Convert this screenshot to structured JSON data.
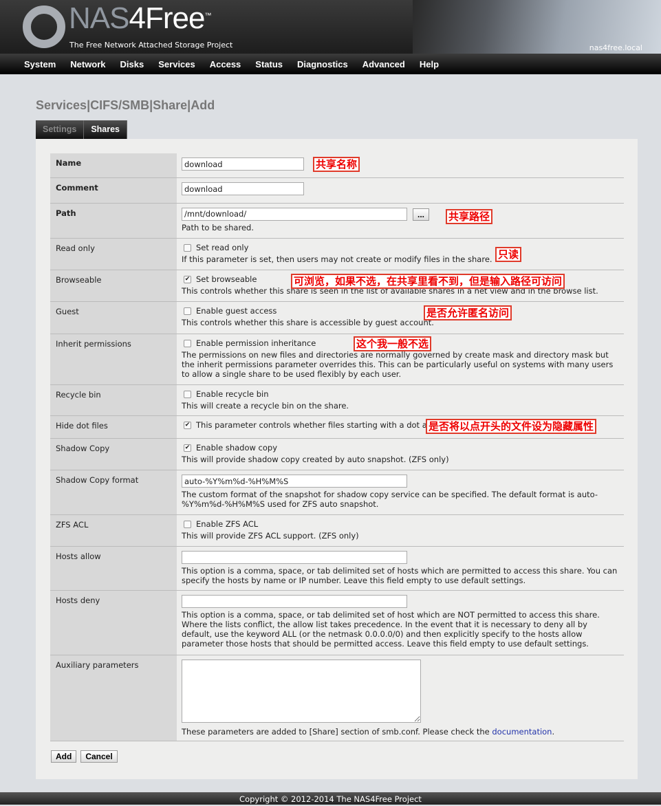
{
  "header": {
    "logo_prefix": "NAS",
    "logo_suffix": "4Free",
    "tm": "™",
    "tagline": "The Free Network Attached Storage Project",
    "hostname": "nas4free.local"
  },
  "nav": [
    "System",
    "Network",
    "Disks",
    "Services",
    "Access",
    "Status",
    "Diagnostics",
    "Advanced",
    "Help"
  ],
  "page_title": "Services|CIFS/SMB|Share|Add",
  "tabs": [
    {
      "label": "Settings",
      "active": false
    },
    {
      "label": "Shares",
      "active": true
    }
  ],
  "rows": [
    {
      "label": "Name",
      "bold": true,
      "type": "text",
      "value": "download",
      "width": 178,
      "h": 36,
      "note": "共享名称",
      "nx": 455
    },
    {
      "label": "Comment",
      "bold": true,
      "type": "text",
      "value": "download",
      "width": 178,
      "h": 37
    },
    {
      "label": "Path",
      "bold": true,
      "type": "path",
      "value": "/mnt/download/",
      "browse": "...",
      "desc": "Path to be shared.",
      "width": 328,
      "h": 51,
      "note": "共享路径",
      "nx": 648
    },
    {
      "label": "Read only",
      "type": "check",
      "checked": false,
      "check_label": "Set read only",
      "desc": "If this parameter is set, then users may not create or modify files in the share.",
      "h": 46,
      "note": "只读",
      "nx": 720
    },
    {
      "label": "Browseable",
      "type": "check",
      "checked": true,
      "check_label": "Set browseable",
      "desc": "This controls whether this share is seen in the list of available shares in a net view and in the browse list.",
      "h": 46,
      "note": "可浏览，如果不选，在共享里看不到，但是输入路径可访问",
      "nx": 423
    },
    {
      "label": "Guest",
      "type": "check",
      "checked": false,
      "check_label": "Enable guest access",
      "desc": "This controls whether this share is accessible by guest account.",
      "h": 47,
      "note": "是否允许匿名访问",
      "nx": 616
    },
    {
      "label": "Inherit permissions",
      "type": "check",
      "checked": false,
      "check_label": "Enable permission inheritance",
      "desc": "The permissions on new files and directories are normally governed by create mask and directory mask but the inherit permissions parameter overrides this. This can be particularly useful on systems with many users to allow a single share to be used flexibly by each user.",
      "h": 74,
      "note": "这个我一般不选",
      "nx": 514
    },
    {
      "label": "Recycle bin",
      "type": "check",
      "checked": false,
      "check_label": "Enable recycle bin",
      "desc": "This will create a recycle bin on the share.",
      "h": 45
    },
    {
      "label": "Hide dot files",
      "type": "check",
      "checked": true,
      "check_label": "This parameter controls whether files starting with a dot appear as hidden files.",
      "h": 33,
      "note": "是否将以点开头的文件设为隐藏属性",
      "nx": 619
    },
    {
      "label": "Shadow Copy",
      "type": "check",
      "checked": true,
      "check_label": "Enable shadow copy",
      "desc": "This will provide shadow copy created by auto snapshot. (ZFS only)",
      "h": 46
    },
    {
      "label": "Shadow Copy format",
      "type": "text",
      "value": "auto-%Y%m%d-%H%M%S",
      "width": 328,
      "desc": "The custom format of the snapshot for shadow copy service can be specified. The default format is auto-%Y%m%d-%H%M%S used for ZFS auto snapshot.",
      "h": 65
    },
    {
      "label": "ZFS ACL",
      "type": "check",
      "checked": false,
      "check_label": "Enable ZFS ACL",
      "desc": "This will provide ZFS ACL support. (ZFS only)",
      "h": 46
    },
    {
      "label": "Hosts allow",
      "type": "text",
      "value": "",
      "width": 328,
      "desc": "This option is a comma, space, or tab delimited set of hosts which are permitted to access this share. You can specify the hosts by name or IP number. Leave this field empty to use default settings.",
      "h": 64
    },
    {
      "label": "Hosts deny",
      "type": "text",
      "value": "",
      "width": 328,
      "desc": "This option is a comma, space, or tab delimited set of host which are NOT permitted to access this share. Where the lists conflict, the allow list takes precedence. In the event that it is necessary to deny all by default, use the keyword ALL (or the netmask 0.0.0.0/0) and then explicitly specify to the hosts allow parameter those hosts that should be permitted access. Leave this field empty to use default settings.",
      "h": 94
    },
    {
      "label": "Auxiliary parameters",
      "type": "textarea",
      "value": "",
      "desc": "These parameters are added to [Share] section of smb.conf. Please check the ",
      "link": "documentation",
      "desc_end": ".",
      "h": 125
    }
  ],
  "buttons": {
    "add": "Add",
    "cancel": "Cancel"
  },
  "footer": "Copyright © 2012-2014 The NAS4Free Project",
  "colors": {
    "annotation": "#e03a2a",
    "link": "#2233aa"
  }
}
